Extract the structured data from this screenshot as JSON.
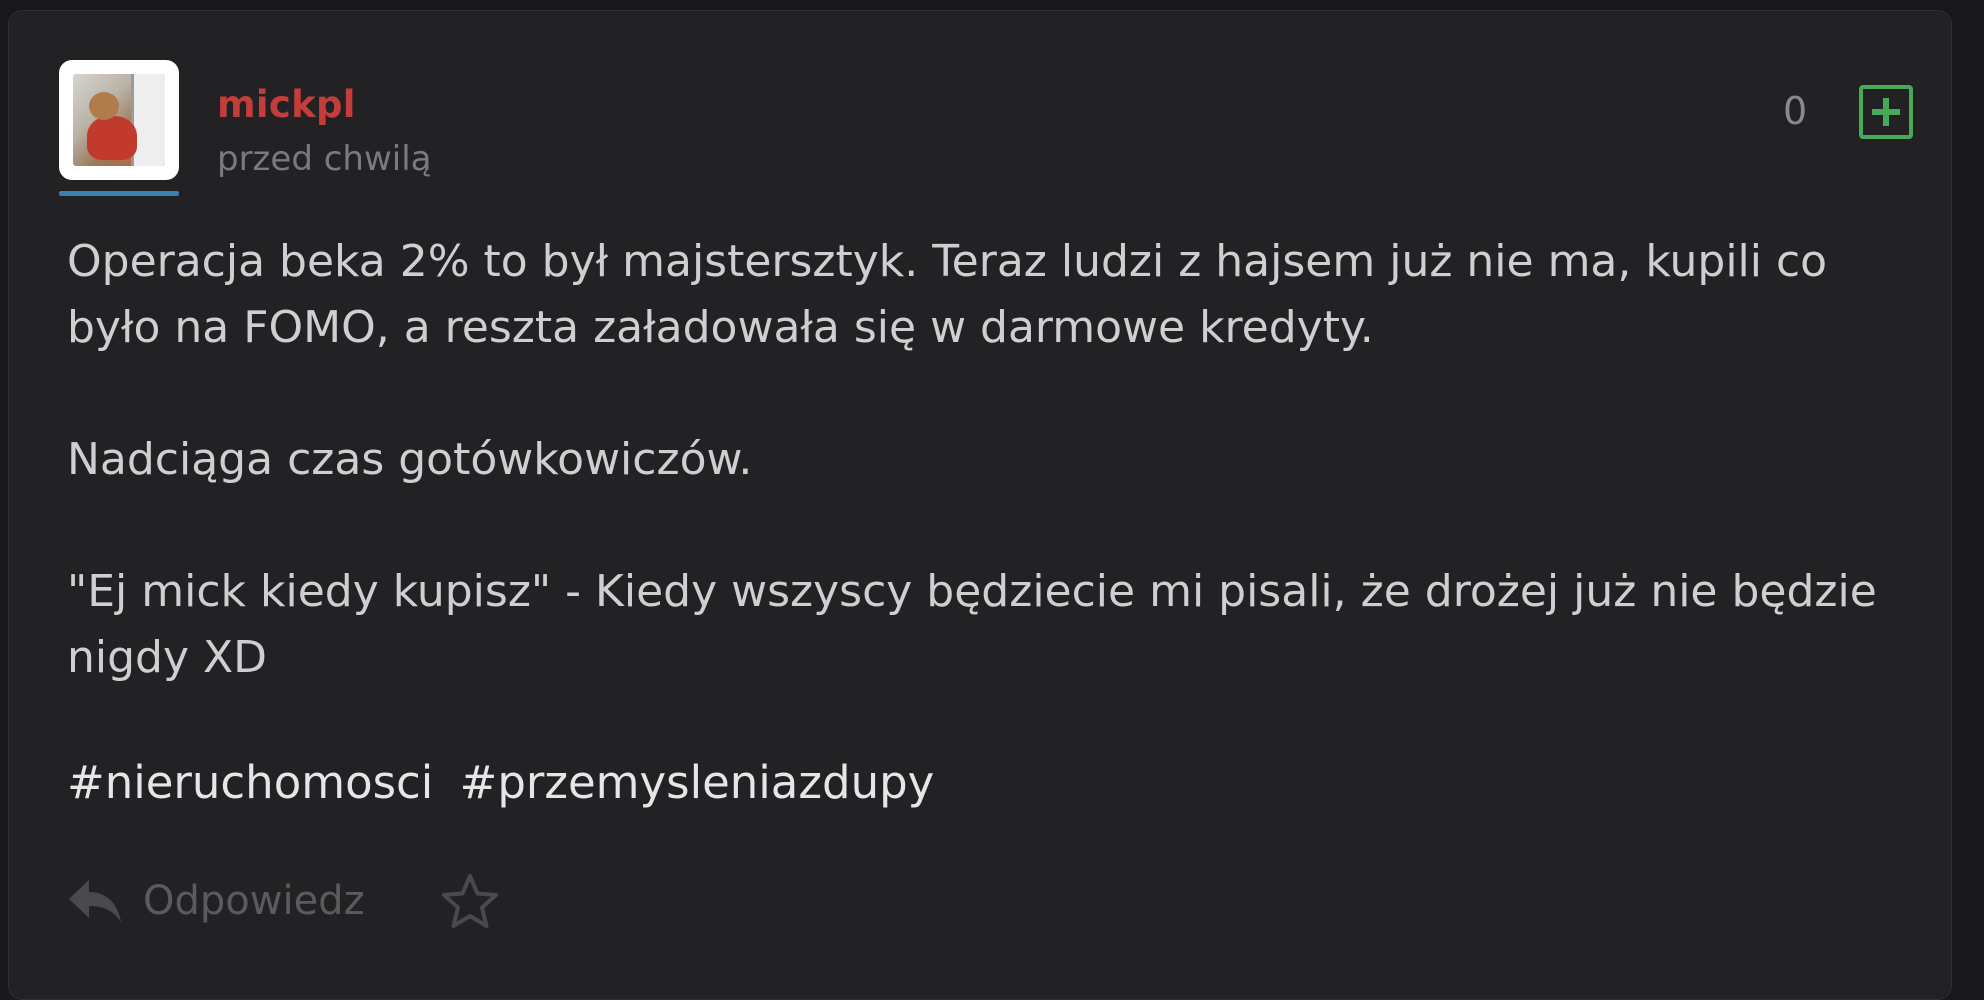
{
  "post": {
    "author": "mickpl",
    "time": "przed chwilą",
    "votes": "0",
    "paragraphs": [
      "Operacja beka 2% to był majstersztyk. Teraz ludzi z hajsem już nie ma, kupili co było na FOMO, a reszta załadowała się w darmowe kredyty.",
      "Nadciąga czas gotówkowiczów.",
      "\"Ej mick kiedy kupisz\" - Kiedy wszyscy będziecie mi pisali, że drożej już nie będzie nigdy XD"
    ],
    "tags": [
      "#nieruchomosci",
      "#przemysleniazdupy"
    ]
  },
  "actions": {
    "reply_label": "Odpowiedz",
    "reply_icon": "reply-arrow-icon",
    "favorite_icon": "star-outline-icon",
    "plus_icon": "plus-square-icon"
  },
  "colors": {
    "author": "#c53d3b",
    "plus": "#49a95a",
    "background": "#222224",
    "avatar_underline": "#3d7fb3"
  }
}
